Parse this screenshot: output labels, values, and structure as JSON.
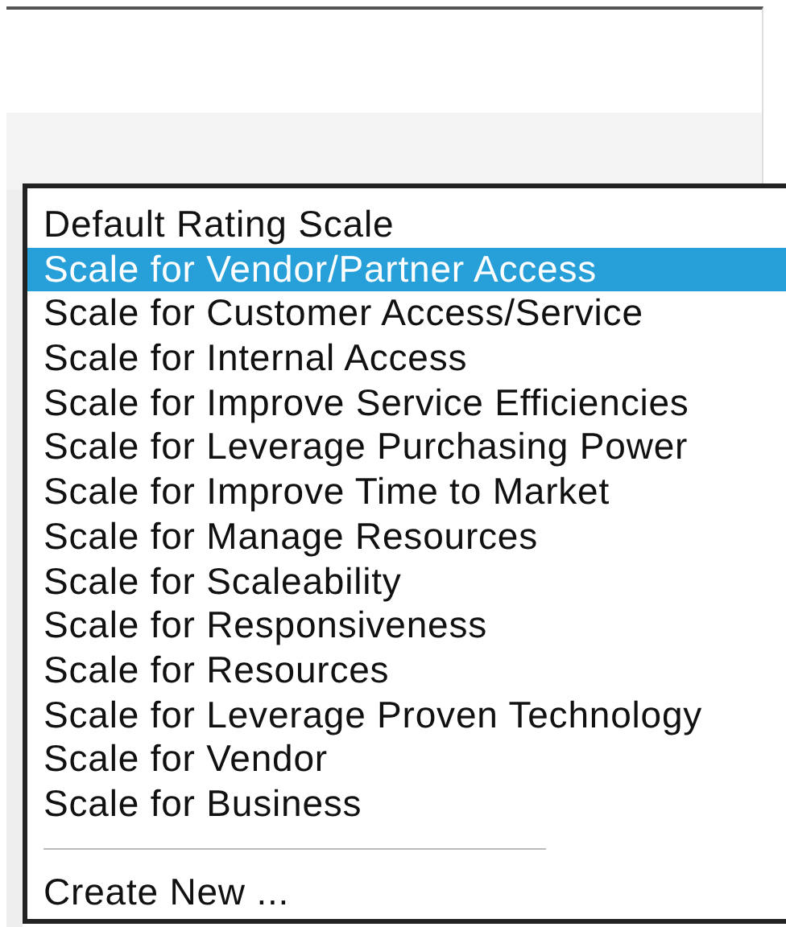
{
  "dropdown": {
    "options": [
      {
        "kind": "option",
        "label": "Default Rating Scale",
        "selected": false
      },
      {
        "kind": "option",
        "label": "Scale for Vendor/Partner Access",
        "selected": true
      },
      {
        "kind": "option",
        "label": "Scale for Customer Access/Service",
        "selected": false
      },
      {
        "kind": "option",
        "label": "Scale for Internal Access",
        "selected": false
      },
      {
        "kind": "option",
        "label": "Scale for Improve Service Efficiencies",
        "selected": false
      },
      {
        "kind": "option",
        "label": "Scale for Leverage Purchasing Power",
        "selected": false
      },
      {
        "kind": "option",
        "label": "Scale for Improve Time to Market",
        "selected": false
      },
      {
        "kind": "option",
        "label": "Scale for Manage Resources",
        "selected": false
      },
      {
        "kind": "option",
        "label": "Scale for Scaleability",
        "selected": false
      },
      {
        "kind": "option",
        "label": "Scale for Responsiveness",
        "selected": false
      },
      {
        "kind": "option",
        "label": "Scale for Resources",
        "selected": false
      },
      {
        "kind": "option",
        "label": "Scale for Leverage Proven Technology",
        "selected": false
      },
      {
        "kind": "option",
        "label": "Scale for Vendor",
        "selected": false
      },
      {
        "kind": "option",
        "label": "Scale for Business",
        "selected": false
      },
      {
        "kind": "separator"
      },
      {
        "kind": "option",
        "label": "Create New ...",
        "selected": false
      }
    ]
  }
}
